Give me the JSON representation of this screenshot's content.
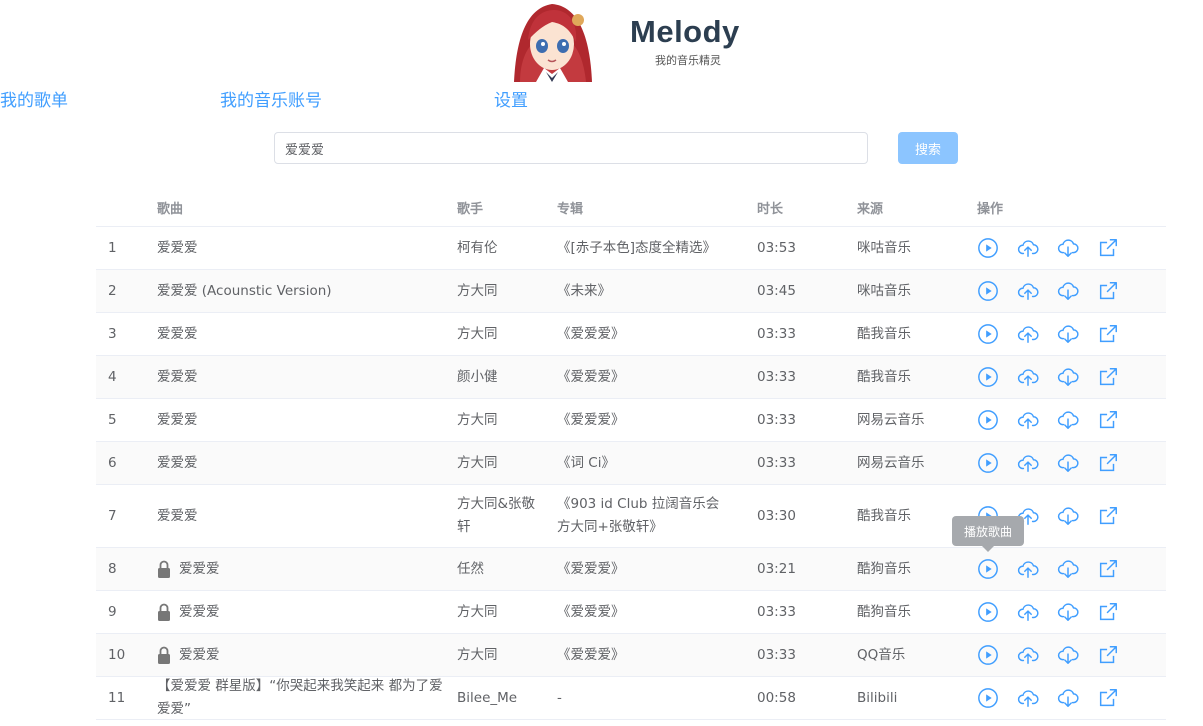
{
  "brand": {
    "title": "Melody",
    "subtitle": "我的音乐精灵"
  },
  "nav": {
    "items": [
      "我的歌单",
      "我的音乐账号",
      "设置"
    ]
  },
  "search": {
    "value": "爱爱爱",
    "button_label": "搜索"
  },
  "table": {
    "headers": {
      "song": "歌曲",
      "singer": "歌手",
      "album": "专辑",
      "duration": "时长",
      "source": "来源",
      "actions": "操作"
    },
    "rows": [
      {
        "index": "1",
        "song": "爱爱爱",
        "singer": "柯有伦",
        "album": "《[赤子本色]态度全精选》",
        "duration": "03:53",
        "source": "咪咕音乐",
        "locked": false
      },
      {
        "index": "2",
        "song": "爱爱爱 (Acounstic Version)",
        "singer": "方大同",
        "album": "《未来》",
        "duration": "03:45",
        "source": "咪咕音乐",
        "locked": false
      },
      {
        "index": "3",
        "song": "爱爱爱",
        "singer": "方大同",
        "album": "《爱爱爱》",
        "duration": "03:33",
        "source": "酷我音乐",
        "locked": false
      },
      {
        "index": "4",
        "song": "爱爱爱",
        "singer": "颜小健",
        "album": "《爱爱爱》",
        "duration": "03:33",
        "source": "酷我音乐",
        "locked": false
      },
      {
        "index": "5",
        "song": "爱爱爱",
        "singer": "方大同",
        "album": "《爱爱爱》",
        "duration": "03:33",
        "source": "网易云音乐",
        "locked": false
      },
      {
        "index": "6",
        "song": "爱爱爱",
        "singer": "方大同",
        "album": "《词 Ci》",
        "duration": "03:33",
        "source": "网易云音乐",
        "locked": false
      },
      {
        "index": "7",
        "song": "爱爱爱",
        "singer": "方大同&张敬轩",
        "album": "《903 id Club 拉阔音乐会 方大同+张敬轩》",
        "duration": "03:30",
        "source": "酷我音乐",
        "locked": false
      },
      {
        "index": "8",
        "song": "爱爱爱",
        "singer": "任然",
        "album": "《爱爱爱》",
        "duration": "03:21",
        "source": "酷狗音乐",
        "locked": true
      },
      {
        "index": "9",
        "song": "爱爱爱",
        "singer": "方大同",
        "album": "《爱爱爱》",
        "duration": "03:33",
        "source": "酷狗音乐",
        "locked": true
      },
      {
        "index": "10",
        "song": "爱爱爱",
        "singer": "方大同",
        "album": "《爱爱爱》",
        "duration": "03:33",
        "source": "QQ音乐",
        "locked": true
      },
      {
        "index": "11",
        "song": "【爱爱爱 群星版】“你哭起来我笑起来 都为了爱爱爱”",
        "singer": "Bilee_Me",
        "album": "-",
        "duration": "00:58",
        "source": "Bilibili",
        "locked": false
      }
    ]
  },
  "tooltip": {
    "text": "播放歌曲"
  },
  "icons": {
    "play": "play-circle-icon",
    "upload": "cloud-upload-icon",
    "download": "cloud-download-icon",
    "open": "external-link-icon",
    "lock": "lock-icon"
  },
  "colors": {
    "accent": "#409eff",
    "button": "#8cc5ff",
    "tooltip": "#a6a9ad"
  }
}
